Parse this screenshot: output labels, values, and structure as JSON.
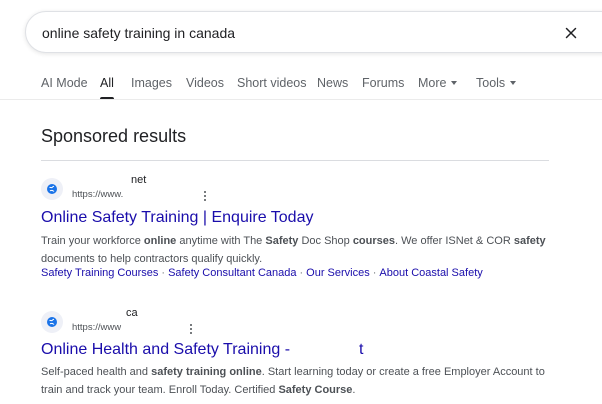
{
  "search": {
    "query": "online safety training in canada"
  },
  "tabs": [
    {
      "label": "AI Mode"
    },
    {
      "label": "All"
    },
    {
      "label": "Images"
    },
    {
      "label": "Videos"
    },
    {
      "label": "Short videos"
    },
    {
      "label": "News"
    },
    {
      "label": "Forums"
    },
    {
      "label": "More"
    },
    {
      "label": "Tools"
    }
  ],
  "sponsored": {
    "heading": "Sponsored results",
    "ads": [
      {
        "site_name": "net",
        "url": "https://www.",
        "title": "Online Safety Training | Enquire Today",
        "desc": [
          {
            "t": "Train your workforce ",
            "b": false
          },
          {
            "t": "online",
            "b": true
          },
          {
            "t": " anytime with The ",
            "b": false
          },
          {
            "t": "Safety",
            "b": true
          },
          {
            "t": " Doc Shop ",
            "b": false
          },
          {
            "t": "courses",
            "b": true
          },
          {
            "t": ". We offer ISNet & COR ",
            "b": false
          },
          {
            "t": "safety",
            "b": true
          },
          {
            "t": " documents to help contractors qualify quickly.",
            "b": false
          }
        ],
        "sitelinks": [
          "Safety Training Courses",
          "Safety Consultant Canada",
          "Our Services",
          "About Coastal Safety"
        ]
      },
      {
        "site_name": "ca",
        "url": "https://www",
        "title": "Online Health and Safety Training -",
        "title_tail": "t",
        "desc": [
          {
            "t": "Self-paced health and ",
            "b": false
          },
          {
            "t": "safety training online",
            "b": true
          },
          {
            "t": ". Start learning today or create a free Employer Account to train and track your team. Enroll Today. Certified ",
            "b": false
          },
          {
            "t": "Safety Course",
            "b": true
          },
          {
            "t": ".",
            "b": false
          }
        ]
      }
    ]
  },
  "colors": {
    "link": "#1a0dab",
    "text": "#202124",
    "muted": "#4d5156"
  },
  "icons": {
    "clear": "close-icon",
    "favicon": "globe-icon",
    "more": "more-vert-icon",
    "caret": "caret-down-icon"
  }
}
